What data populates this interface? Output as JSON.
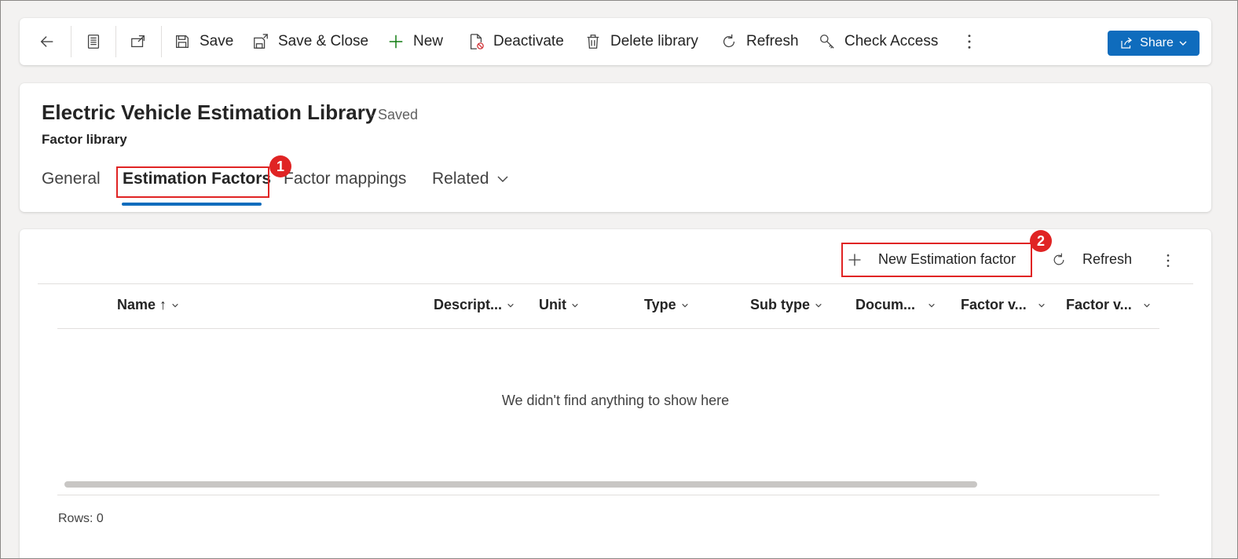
{
  "command_bar": {
    "save_label": "Save",
    "save_close_label": "Save & Close",
    "new_label": "New",
    "deactivate_label": "Deactivate",
    "delete_label": "Delete library",
    "refresh_label": "Refresh",
    "check_access_label": "Check Access",
    "share_label": "Share"
  },
  "record": {
    "title": "Electric Vehicle Estimation Library",
    "status": "- Saved",
    "entity": "Factor library"
  },
  "tabs": [
    {
      "label": "General"
    },
    {
      "label": "Estimation Factors"
    },
    {
      "label": "Factor mappings"
    },
    {
      "label": "Related"
    }
  ],
  "callouts": {
    "one": "1",
    "two": "2"
  },
  "subgrid": {
    "new_label": "New Estimation factor",
    "refresh_label": "Refresh",
    "columns": [
      "Name ↑",
      "Descript...",
      "Unit",
      "Type",
      "Sub type",
      "Docum...",
      "Factor v...",
      "Factor v..."
    ],
    "empty_message": "We didn't find anything to show here",
    "rows_label": "Rows: 0"
  },
  "colors": {
    "accent": "#0f6cbd",
    "callout": "#e02424",
    "add_icon": "#107c10"
  }
}
